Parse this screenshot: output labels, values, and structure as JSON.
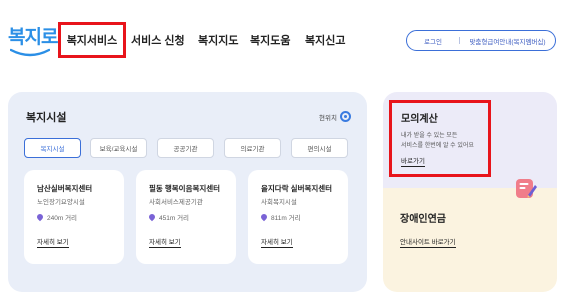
{
  "header": {
    "logo_text": "복지로",
    "nav": [
      {
        "label": "복지서비스",
        "active": true
      },
      {
        "label": "서비스 신청"
      },
      {
        "label": "복지지도"
      },
      {
        "label": "복지도움"
      },
      {
        "label": "복지신고"
      }
    ],
    "login_label": "로그인",
    "service_label": "맞춤형급여안내(복지멤버십)"
  },
  "facilities": {
    "title": "복지시설",
    "location_label": "현위치",
    "tabs": [
      {
        "label": "복지시설",
        "active": true
      },
      {
        "label": "보육/교육시설"
      },
      {
        "label": "공공기관"
      },
      {
        "label": "의료기관"
      },
      {
        "label": "편의시설"
      }
    ],
    "cards": [
      {
        "name": "남산실버복지센터",
        "type": "노인장기요양시설",
        "distance": "240m 거리",
        "link": "자세히 보기"
      },
      {
        "name": "필동 행복이음복지센터",
        "type": "사회서비스제공기관",
        "distance": "451m 거리",
        "link": "자세히 보기"
      },
      {
        "name": "을지다락 실버복지센터",
        "type": "사회복지시설",
        "distance": "811m 거리",
        "link": "자세히 보기"
      }
    ]
  },
  "calculator": {
    "title": "모의계산",
    "desc_line1": "내가 받을 수 있는 모든",
    "desc_line2": "서비스를 한번에 알 수 있어요",
    "link": "바로가기"
  },
  "pension": {
    "title": "장애인연금",
    "link": "안내사이트 바로가기"
  },
  "colors": {
    "highlight": "#e8141b",
    "brand_blue": "#2b8fe6",
    "accent_blue": "#3b6fd8",
    "facility_bg": "#e9eef8",
    "calc_bg": "#ecebf8",
    "pension_bg": "#fbf3e0"
  }
}
